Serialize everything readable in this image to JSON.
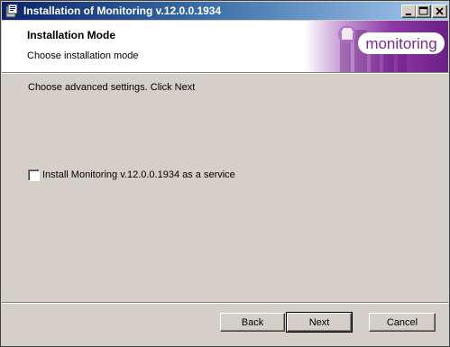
{
  "window": {
    "title": "Installation of Monitoring v.12.0.0.1934",
    "controls": [
      "minimize",
      "maximize",
      "close"
    ]
  },
  "header": {
    "title": "Installation Mode",
    "subtitle": "Choose installation mode",
    "brand": "monitoring"
  },
  "main": {
    "instruction": "Choose advanced settings. Click Next",
    "service_checkbox": {
      "label": "Install Monitoring v.12.0.0.1934 as a service",
      "checked": false
    }
  },
  "footer": {
    "back_label": "Back",
    "next_label": "Next",
    "cancel_label": "Cancel"
  },
  "colors": {
    "titlebar_start": "#0a246a",
    "titlebar_end": "#a6caf0",
    "dialog_bg": "#d4d0c8",
    "brand_purple": "#7a2a8c"
  }
}
